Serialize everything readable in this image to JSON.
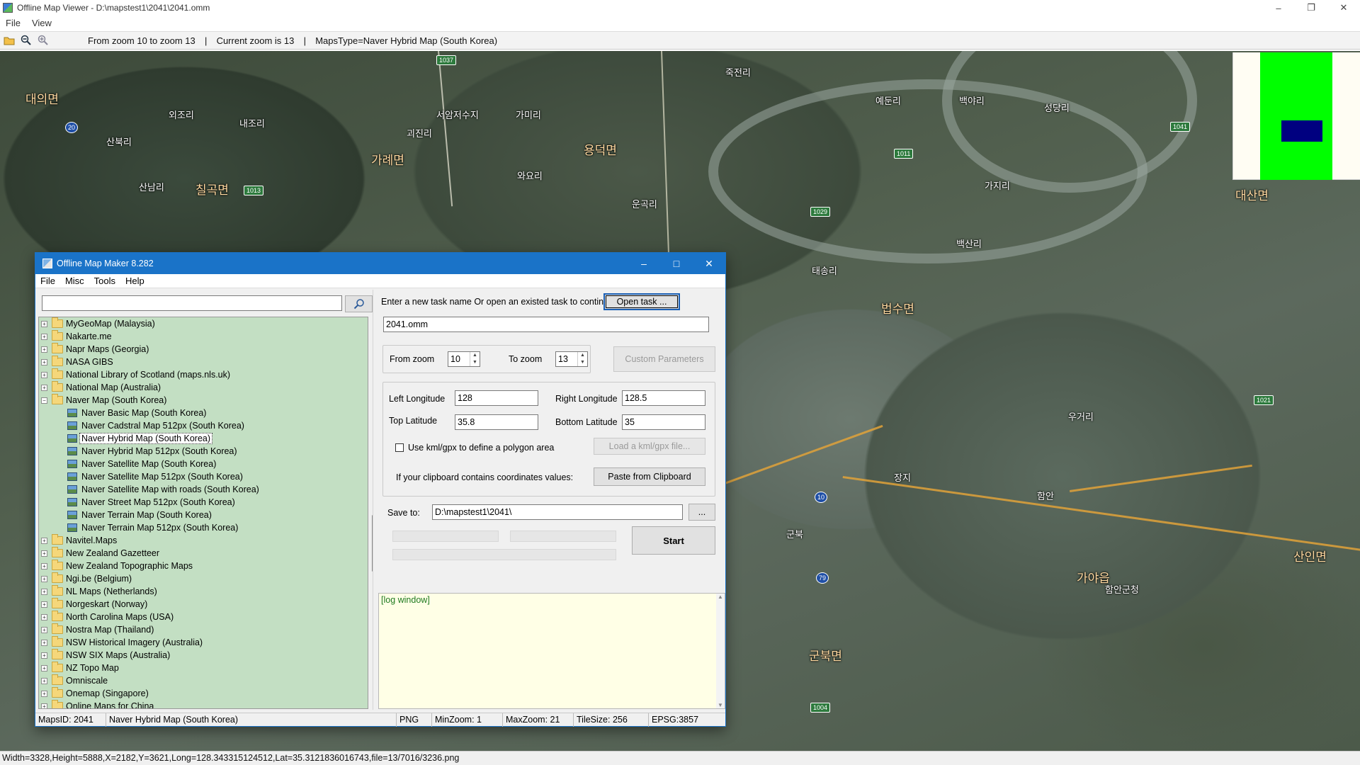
{
  "viewer": {
    "title": "Offline Map Viewer - D:\\mapstest1\\2041\\2041.omm",
    "menu": [
      "File",
      "View"
    ],
    "toolbar_info": {
      "zoom_range": "From zoom 10 to zoom 13",
      "current_zoom": "Current zoom is 13",
      "maps_type": "MapsType=Naver Hybrid Map (South Korea)"
    },
    "status": "Width=3328,Height=5888,X=2182,Y=3621,Long=128.343315124512,Lat=35.3121836016743,file=13/7016/3236.png"
  },
  "map_labels": [
    {
      "text": "대의면",
      "big": true
    },
    {
      "text": "외조리",
      "big": false
    },
    {
      "text": "산북리",
      "big": false
    },
    {
      "text": "산남리",
      "big": false
    },
    {
      "text": "칠곡면",
      "big": true
    },
    {
      "text": "내조리",
      "big": false
    },
    {
      "text": "서암저수지",
      "big": false
    },
    {
      "text": "가미리",
      "big": false
    },
    {
      "text": "괴진리",
      "big": false
    },
    {
      "text": "가례면",
      "big": true
    },
    {
      "text": "용덕면",
      "big": true
    },
    {
      "text": "와요리",
      "big": false
    },
    {
      "text": "운곡리",
      "big": false
    },
    {
      "text": "죽전리",
      "big": false
    },
    {
      "text": "예둔리",
      "big": false
    },
    {
      "text": "백야리",
      "big": false
    },
    {
      "text": "성당리",
      "big": false
    },
    {
      "text": "가지리",
      "big": false
    },
    {
      "text": "백산리",
      "big": false
    },
    {
      "text": "법수면",
      "big": true
    },
    {
      "text": "태송리",
      "big": false
    },
    {
      "text": "우거리",
      "big": false
    },
    {
      "text": "장지",
      "big": false
    },
    {
      "text": "함안",
      "big": false
    },
    {
      "text": "군북",
      "big": false
    },
    {
      "text": "가야읍",
      "big": true
    },
    {
      "text": "산인면",
      "big": true
    },
    {
      "text": "대산면",
      "big": true
    },
    {
      "text": "함안군청",
      "big": false
    },
    {
      "text": "군북면",
      "big": true
    }
  ],
  "road_shields": [
    "1037",
    "1013",
    "20",
    "1041",
    "1011",
    "1029",
    "1021",
    "10",
    "79",
    "1004"
  ],
  "dialog": {
    "title": "Offline Map Maker 8.282",
    "menu": [
      "File",
      "Misc",
      "Tools",
      "Help"
    ],
    "search_placeholder": "",
    "tree": [
      {
        "label": "MyGeoMap (Malaysia)",
        "type": "folder",
        "expanded": false
      },
      {
        "label": "Nakarte.me",
        "type": "folder",
        "expanded": false
      },
      {
        "label": "Napr Maps (Georgia)",
        "type": "folder",
        "expanded": false
      },
      {
        "label": "NASA GIBS",
        "type": "folder",
        "expanded": false
      },
      {
        "label": "National Library of Scotland (maps.nls.uk)",
        "type": "folder",
        "expanded": false
      },
      {
        "label": "National Map (Australia)",
        "type": "folder",
        "expanded": false
      },
      {
        "label": "Naver Map (South Korea)",
        "type": "folder",
        "expanded": true
      },
      {
        "label": "Naver Basic Map (South Korea)",
        "type": "map"
      },
      {
        "label": "Naver Cadstral Map 512px (South Korea)",
        "type": "map"
      },
      {
        "label": "Naver Hybrid Map (South Korea)",
        "type": "map",
        "selected": true
      },
      {
        "label": "Naver Hybrid Map 512px (South Korea)",
        "type": "map"
      },
      {
        "label": "Naver Satellite Map (South Korea)",
        "type": "map"
      },
      {
        "label": "Naver Satellite Map 512px (South Korea)",
        "type": "map"
      },
      {
        "label": "Naver Satellite Map with roads (South Korea)",
        "type": "map"
      },
      {
        "label": "Naver Street Map 512px (South Korea)",
        "type": "map"
      },
      {
        "label": "Naver Terrain Map (South Korea)",
        "type": "map"
      },
      {
        "label": "Naver Terrain Map 512px (South Korea)",
        "type": "map"
      },
      {
        "label": "Navitel.Maps",
        "type": "folder",
        "expanded": false
      },
      {
        "label": "New Zealand Gazetteer",
        "type": "folder",
        "expanded": false
      },
      {
        "label": "New Zealand Topographic Maps",
        "type": "folder",
        "expanded": false
      },
      {
        "label": "Ngi.be (Belgium)",
        "type": "folder",
        "expanded": false
      },
      {
        "label": "NL Maps (Netherlands)",
        "type": "folder",
        "expanded": false
      },
      {
        "label": "Norgeskart (Norway)",
        "type": "folder",
        "expanded": false
      },
      {
        "label": "North Carolina Maps (USA)",
        "type": "folder",
        "expanded": false
      },
      {
        "label": "Nostra Map (Thailand)",
        "type": "folder",
        "expanded": false
      },
      {
        "label": "NSW Historical Imagery (Australia)",
        "type": "folder",
        "expanded": false
      },
      {
        "label": "NSW SIX Maps (Australia)",
        "type": "folder",
        "expanded": false
      },
      {
        "label": "NZ Topo Map",
        "type": "folder",
        "expanded": false
      },
      {
        "label": "Omniscale",
        "type": "folder",
        "expanded": false
      },
      {
        "label": "Onemap (Singapore)",
        "type": "folder",
        "expanded": false
      },
      {
        "label": "Online Maps for China",
        "type": "folder",
        "expanded": false
      }
    ],
    "task_prompt": "Enter a new task name Or open an existed task to continue:",
    "open_task_label": "Open task ...",
    "task_name": "2041.omm",
    "from_zoom_label": "From zoom",
    "from_zoom": "10",
    "to_zoom_label": "To zoom",
    "to_zoom": "13",
    "custom_params_label": "Custom Parameters",
    "left_lon_label": "Left Longitude",
    "left_lon": "128",
    "right_lon_label": "Right Longitude",
    "right_lon": "128.5",
    "top_lat_label": "Top Latitude",
    "top_lat": "35.8",
    "bottom_lat_label": "Bottom Latitude",
    "bottom_lat": "35",
    "kml_label": "Use kml/gpx to define a polygon area",
    "kml_checked": false,
    "load_kml_label": "Load a kml/gpx file...",
    "clipboard_label": "If your clipboard contains coordinates values:",
    "paste_label": "Paste from Clipboard",
    "save_to_label": "Save to:",
    "save_to": "D:\\mapstest1\\2041\\",
    "browse_label": "...",
    "start_label": "Start",
    "progress": [
      0,
      0,
      0
    ],
    "log_text": "[log window]",
    "status": {
      "maps_id": "MapsID: 2041",
      "map_name": "Naver Hybrid Map (South Korea)",
      "format": "PNG",
      "min_zoom": "MinZoom: 1",
      "max_zoom": "MaxZoom: 21",
      "tile_size": "TileSize: 256",
      "epsg": "EPSG:3857"
    }
  },
  "colors": {
    "dialog_title": "#1a73c8",
    "tree_bg": "#c3dfc3",
    "log_bg": "#ffffe6",
    "overview_green": "#00ff00",
    "overview_blue": "#000080"
  }
}
